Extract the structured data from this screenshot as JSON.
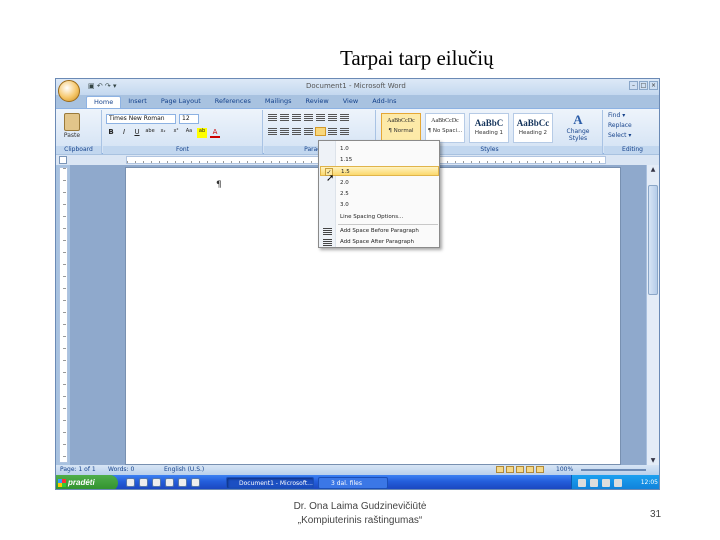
{
  "slide": {
    "title": "Tarpai tarp eilučių",
    "footer_author": "Dr. Ona Laima Gudzinevičiūtė",
    "footer_course": "„Kompiuterinis raštingumas“",
    "page_number": "31"
  },
  "window": {
    "title": "Document1 - Microsoft Word",
    "qat": "▣ ↶ ↷ ▾"
  },
  "tabs": [
    {
      "label": "Home",
      "active": true
    },
    {
      "label": "Insert"
    },
    {
      "label": "Page Layout"
    },
    {
      "label": "References"
    },
    {
      "label": "Mailings"
    },
    {
      "label": "Review"
    },
    {
      "label": "View"
    },
    {
      "label": "Add-Ins"
    }
  ],
  "ribbon": {
    "clipboard": {
      "paste_label": "Paste",
      "group_label": "Clipboard"
    },
    "font": {
      "font_name": "Times New Roman",
      "font_size": "12",
      "group_label": "Font",
      "format_buttons": [
        "B",
        "I",
        "U",
        "abe",
        "x₂",
        "x²",
        "Aa",
        "ab",
        "A"
      ]
    },
    "paragraph": {
      "group_label": "Paragraph"
    },
    "styles": {
      "group_label": "Styles",
      "items": [
        {
          "sample": "AaBbCcDc",
          "name": "¶ Normal",
          "selected": true,
          "big": false
        },
        {
          "sample": "AaBbCcDc",
          "name": "¶ No Spaci...",
          "selected": false,
          "big": false
        },
        {
          "sample": "AaBbC",
          "name": "Heading 1",
          "selected": false,
          "big": true
        },
        {
          "sample": "AaBbCc",
          "name": "Heading 2",
          "selected": false,
          "big": true
        }
      ],
      "change_styles": "Change Styles"
    },
    "editing": {
      "group_label": "Editing",
      "items": [
        "Find ▾",
        "Replace",
        "Select ▾"
      ]
    }
  },
  "document": {
    "pilcrow": "¶"
  },
  "status": {
    "page": "Page: 1 of 1",
    "words": "Words: 0",
    "language": "English (U.S.)",
    "zoom": "100%"
  },
  "taskbar": {
    "start_label": "pradėti",
    "tasks": [
      "Document1 - Microsoft...",
      "3 dal. files"
    ],
    "clock": "12:05"
  },
  "line_spacing_menu": {
    "options": [
      {
        "label": "1.0",
        "checked": false
      },
      {
        "label": "1.15",
        "checked": false
      },
      {
        "label": "1.5",
        "checked": true
      },
      {
        "label": "2.0",
        "checked": false
      },
      {
        "label": "2.5",
        "checked": false
      },
      {
        "label": "3.0",
        "checked": false
      }
    ],
    "line_spacing_options": "Line Spacing Options...",
    "add_before": "Add Space Before Paragraph",
    "add_after": "Add Space After Paragraph"
  },
  "colors": {
    "ribbon_blue": "#15428b",
    "highlight": "#fbd86c",
    "taskbar": "#245edb",
    "start_green": "#2f8f2c"
  }
}
